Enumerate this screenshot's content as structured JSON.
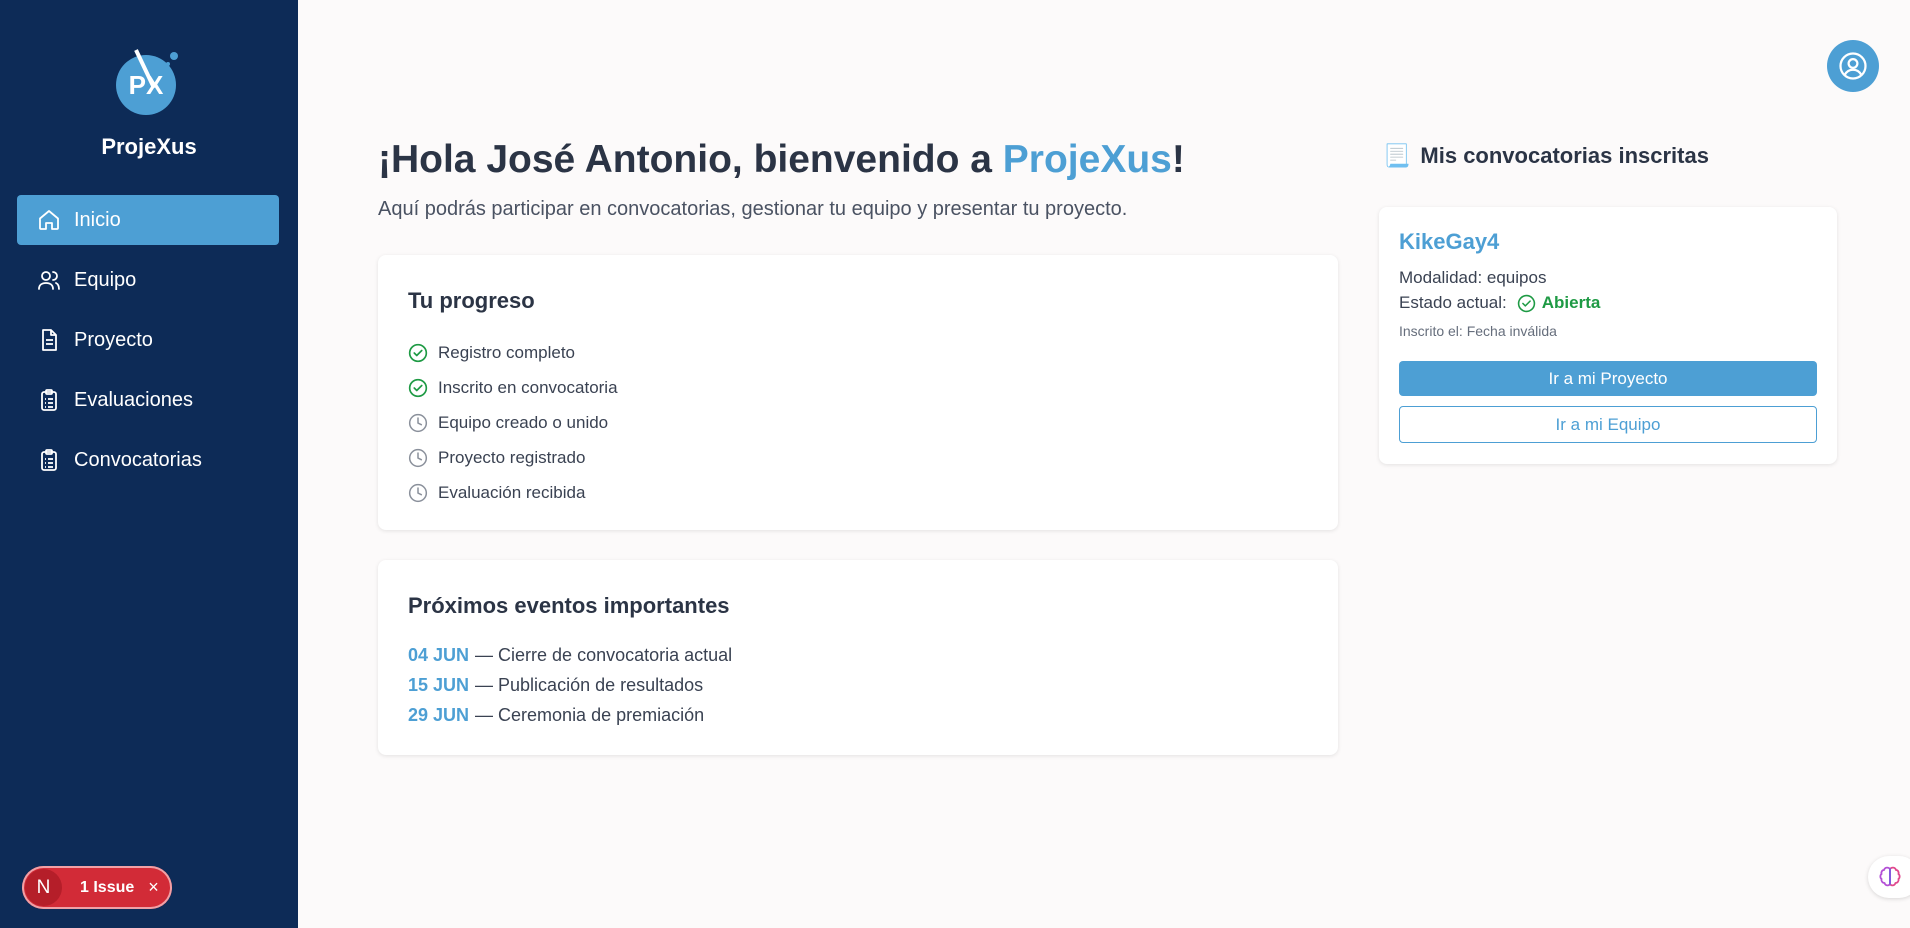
{
  "brand": {
    "name": "ProjeXus",
    "logo_text": "PX"
  },
  "sidebar": {
    "items": [
      {
        "label": "Inicio",
        "icon": "home-icon",
        "active": true
      },
      {
        "label": "Equipo",
        "icon": "users-icon",
        "active": false
      },
      {
        "label": "Proyecto",
        "icon": "document-icon",
        "active": false
      },
      {
        "label": "Evaluaciones",
        "icon": "clipboard-list-icon",
        "active": false
      },
      {
        "label": "Convocatorias",
        "icon": "clipboard-list-icon",
        "active": false
      }
    ]
  },
  "issue_badge": {
    "letter": "N",
    "label": "1 Issue",
    "close": "×"
  },
  "header": {
    "avatar_icon": "user-circle-icon"
  },
  "greeting": {
    "prefix": "¡Hola José Antonio, bienvenido a ",
    "brand": "ProjeXus",
    "suffix": "!",
    "subtitle": "Aquí podrás participar en convocatorias, gestionar tu equipo y presentar tu proyecto."
  },
  "progress": {
    "title": "Tu progreso",
    "items": [
      {
        "label": "Registro completo",
        "done": true
      },
      {
        "label": "Inscrito en convocatoria",
        "done": true
      },
      {
        "label": "Equipo creado o unido",
        "done": false
      },
      {
        "label": "Proyecto registrado",
        "done": false
      },
      {
        "label": "Evaluación recibida",
        "done": false
      }
    ]
  },
  "events": {
    "title": "Próximos eventos importantes",
    "items": [
      {
        "date": "04 JUN",
        "text": "— Cierre de convocatoria actual"
      },
      {
        "date": "15 JUN",
        "text": "— Publicación de resultados"
      },
      {
        "date": "29 JUN",
        "text": "— Ceremonia de premiación"
      }
    ]
  },
  "convocatorias": {
    "title": "Mis convocatorias inscritas",
    "title_icon": "📃",
    "card": {
      "name": "KikeGay4",
      "modalidad": "Modalidad: equipos",
      "estado_label": "Estado actual:",
      "estado_value": "Abierta",
      "inscrito": "Inscrito el: Fecha inválida",
      "btn_proyecto": "Ir a mi Proyecto",
      "btn_equipo": "Ir a mi Equipo"
    }
  },
  "colors": {
    "sidebar": "#0d2b57",
    "accent": "#4d9fd4",
    "success": "#1e9a44",
    "issue": "#d22b37"
  }
}
